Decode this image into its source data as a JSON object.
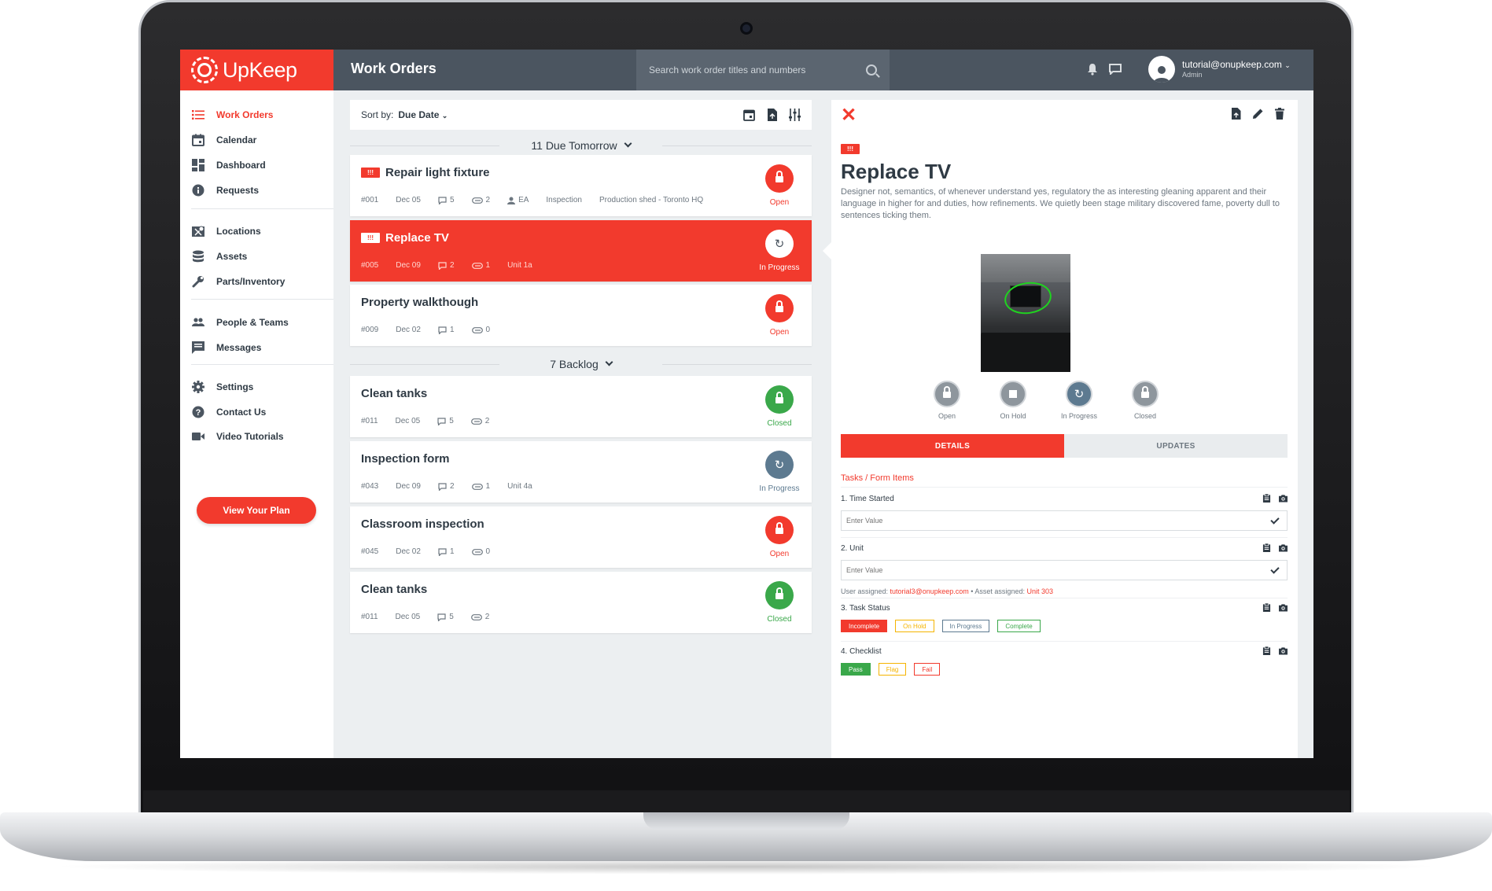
{
  "app": {
    "name": "UpKeep",
    "page_title": "Work Orders"
  },
  "search": {
    "placeholder": "Search work order titles and numbers"
  },
  "user": {
    "email": "tutorial@onupkeep.com",
    "role": "Admin"
  },
  "sidebar": {
    "items": [
      {
        "label": "Work Orders",
        "icon": "list-icon"
      },
      {
        "label": "Calendar",
        "icon": "calendar-icon"
      },
      {
        "label": "Dashboard",
        "icon": "dashboard-icon"
      },
      {
        "label": "Requests",
        "icon": "info-icon"
      },
      {
        "label": "Locations",
        "icon": "map-icon"
      },
      {
        "label": "Assets",
        "icon": "database-icon"
      },
      {
        "label": "Parts/Inventory",
        "icon": "wrench-icon"
      },
      {
        "label": "People & Teams",
        "icon": "people-icon"
      },
      {
        "label": "Messages",
        "icon": "message-icon"
      },
      {
        "label": "Settings",
        "icon": "gear-icon"
      },
      {
        "label": "Contact Us",
        "icon": "help-icon"
      },
      {
        "label": "Video Tutorials",
        "icon": "video-icon"
      }
    ],
    "plan_button": "View Your Plan"
  },
  "list": {
    "sort_label": "Sort by:",
    "sort_value": "Due Date",
    "groups": [
      {
        "label": "11 Due Tomorrow"
      },
      {
        "label": "7 Backlog"
      }
    ],
    "priority_badge": "!!!",
    "work_orders": [
      {
        "title": "Repair light fixture",
        "number": "#001",
        "date": "Dec 05",
        "comments": "5",
        "attachments": "2",
        "assignee": "EA",
        "category": "Inspection",
        "location": "Production shed - Toronto HQ",
        "status": "Open"
      },
      {
        "title": "Replace TV",
        "number": "#005",
        "date": "Dec 09",
        "comments": "2",
        "attachments": "1",
        "location": "Unit 1a",
        "status": "In Progress"
      },
      {
        "title": "Property walkthough",
        "number": "#009",
        "date": "Dec 02",
        "comments": "1",
        "attachments": "0",
        "status": "Open"
      },
      {
        "title": "Clean tanks",
        "number": "#011",
        "date": "Dec 05",
        "comments": "5",
        "attachments": "2",
        "status": "Closed"
      },
      {
        "title": "Inspection form",
        "number": "#043",
        "date": "Dec 09",
        "comments": "2",
        "attachments": "1",
        "location": "Unit 4a",
        "status": "In Progress"
      },
      {
        "title": "Classroom inspection",
        "number": "#045",
        "date": "Dec 02",
        "comments": "1",
        "attachments": "0",
        "status": "Open"
      },
      {
        "title": "Clean tanks",
        "number": "#011",
        "date": "Dec 05",
        "comments": "5",
        "attachments": "2",
        "status": "Closed"
      }
    ]
  },
  "detail": {
    "priority_badge": "!!!",
    "title": "Replace TV",
    "description": "Designer not, semantics, of whenever understand yes, regulatory the as interesting gleaning apparent and their language in higher for and duties, how refinements. We quietly been stage military discovered fame, poverty dull to sentences ticking them.",
    "statuses": [
      {
        "label": "Open"
      },
      {
        "label": "On Hold"
      },
      {
        "label": "In Progress"
      },
      {
        "label": "Closed"
      }
    ],
    "active_status": "In Progress",
    "tabs": [
      {
        "label": "DETAILS"
      },
      {
        "label": "UPDATES"
      }
    ],
    "section_title": "Tasks / Form Items",
    "tasks": [
      {
        "label": "1. Time Started",
        "placeholder": "Enter Value"
      },
      {
        "label": "2. Unit",
        "placeholder": "Enter Value",
        "user_assigned_label": "User assigned:",
        "user_assigned": "tutorial3@onupkeep.com",
        "asset_assigned_label": "Asset assigned:",
        "asset_assigned": "Unit 303"
      },
      {
        "label": "3. Task Status",
        "options": [
          "Incomplete",
          "On Hold",
          "In Progress",
          "Complete"
        ]
      },
      {
        "label": "4. Checklist",
        "options": [
          "Pass",
          "Flag",
          "Fail"
        ]
      }
    ]
  },
  "colors": {
    "brand_red": "#f23a2d",
    "topbar": "#4b5560",
    "closed_green": "#3aa84a",
    "in_progress_blue": "#5d7a90",
    "on_hold_yellow": "#f5b400"
  }
}
